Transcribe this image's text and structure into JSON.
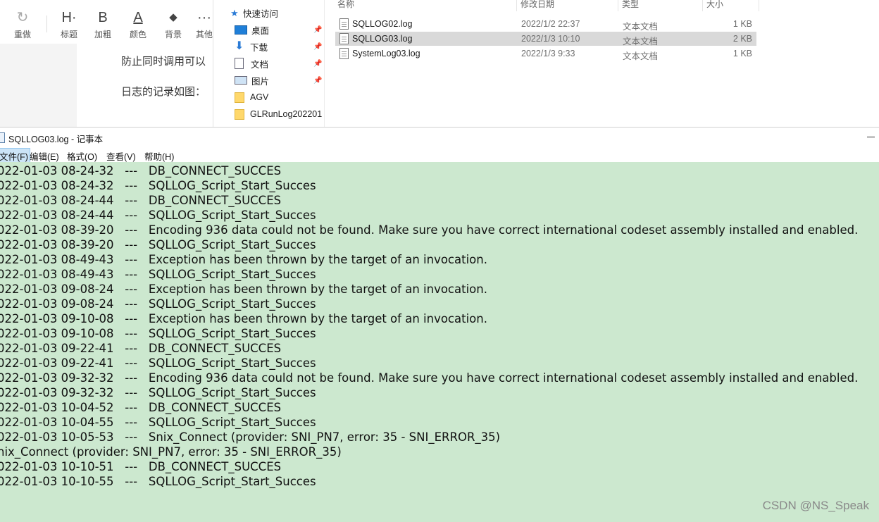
{
  "editor": {
    "toolbar": [
      {
        "name": "redo",
        "icon": "redo-icon",
        "glyph": "↻",
        "label": "重做"
      },
      {
        "name": "heading",
        "icon": "heading-icon",
        "glyph": "H·",
        "label": "标题"
      },
      {
        "name": "bold",
        "icon": "bold-icon",
        "glyph": "B",
        "label": "加粗"
      },
      {
        "name": "color",
        "icon": "font-color-icon",
        "glyph": "A",
        "label": "颜色"
      },
      {
        "name": "background",
        "icon": "paint-bucket-icon",
        "glyph": "◆",
        "label": "背景"
      },
      {
        "name": "more",
        "icon": "more-icon",
        "glyph": "···",
        "label": "其他"
      }
    ],
    "paragraphs": [
      "防止同时调用可以",
      "日志的记录如图："
    ]
  },
  "explorer": {
    "nav": [
      {
        "label": "快速访问",
        "icon": "star-icon",
        "pinned": false
      },
      {
        "label": "桌面",
        "icon": "desktop-icon",
        "pinned": true
      },
      {
        "label": "下载",
        "icon": "download-icon",
        "pinned": true
      },
      {
        "label": "文档",
        "icon": "document-icon",
        "pinned": true
      },
      {
        "label": "图片",
        "icon": "picture-icon",
        "pinned": true
      },
      {
        "label": "AGV",
        "icon": "folder-icon",
        "pinned": false
      },
      {
        "label": "GLRunLog202201",
        "icon": "folder-icon",
        "pinned": false
      }
    ],
    "columns": {
      "name": "名称",
      "date": "修改日期",
      "type": "类型",
      "size": "大小"
    },
    "files": [
      {
        "name": "SQLLOG02.log",
        "date": "2022/1/2 22:37",
        "type": "文本文档",
        "size": "1 KB",
        "selected": false
      },
      {
        "name": "SQLLOG03.log",
        "date": "2022/1/3 10:10",
        "type": "文本文档",
        "size": "2 KB",
        "selected": true
      },
      {
        "name": "SystemLog03.log",
        "date": "2022/1/3 9:33",
        "type": "文本文档",
        "size": "1 KB",
        "selected": false
      }
    ]
  },
  "notepad": {
    "title": "SQLLOG03.log - 记事本",
    "menu": [
      {
        "label": "文件(F)",
        "active": true
      },
      {
        "label": "编辑(E)",
        "active": false
      },
      {
        "label": "格式(O)",
        "active": false
      },
      {
        "label": "查看(V)",
        "active": false
      },
      {
        "label": "帮助(H)",
        "active": false
      }
    ],
    "lines": [
      "022-01-03 08-24-32   ---   DB_CONNECT_SUCCES",
      "022-01-03 08-24-32   ---   SQLLOG_Script_Start_Succes",
      "022-01-03 08-24-44   ---   DB_CONNECT_SUCCES",
      "022-01-03 08-24-44   ---   SQLLOG_Script_Start_Succes",
      "022-01-03 08-39-20   ---   Encoding 936 data could not be found. Make sure you have correct international codeset assembly installed and enabled.",
      "022-01-03 08-39-20   ---   SQLLOG_Script_Start_Succes",
      "022-01-03 08-49-43   ---   Exception has been thrown by the target of an invocation.",
      "022-01-03 08-49-43   ---   SQLLOG_Script_Start_Succes",
      "022-01-03 09-08-24   ---   Exception has been thrown by the target of an invocation.",
      "022-01-03 09-08-24   ---   SQLLOG_Script_Start_Succes",
      "022-01-03 09-10-08   ---   Exception has been thrown by the target of an invocation.",
      "022-01-03 09-10-08   ---   SQLLOG_Script_Start_Succes",
      "022-01-03 09-22-41   ---   DB_CONNECT_SUCCES",
      "022-01-03 09-22-41   ---   SQLLOG_Script_Start_Succes",
      "022-01-03 09-32-32   ---   Encoding 936 data could not be found. Make sure you have correct international codeset assembly installed and enabled.",
      "022-01-03 09-32-32   ---   SQLLOG_Script_Start_Succes",
      "022-01-03 10-04-52   ---   DB_CONNECT_SUCCES",
      "022-01-03 10-04-55   ---   SQLLOG_Script_Start_Succes",
      "022-01-03 10-05-53   ---   Snix_Connect (provider: SNI_PN7, error: 35 - SNI_ERROR_35)",
      "nix_Connect (provider: SNI_PN7, error: 35 - SNI_ERROR_35)",
      "022-01-03 10-10-51   ---   DB_CONNECT_SUCCES",
      "022-01-03 10-10-55   ---   SQLLOG_Script_Start_Succes"
    ]
  },
  "watermark": "CSDN @NS_Speak",
  "colors": {
    "notepad_bg": "#cce8cf",
    "selected_row": "#d9d9d9",
    "menu_active": "#cce4f7"
  }
}
